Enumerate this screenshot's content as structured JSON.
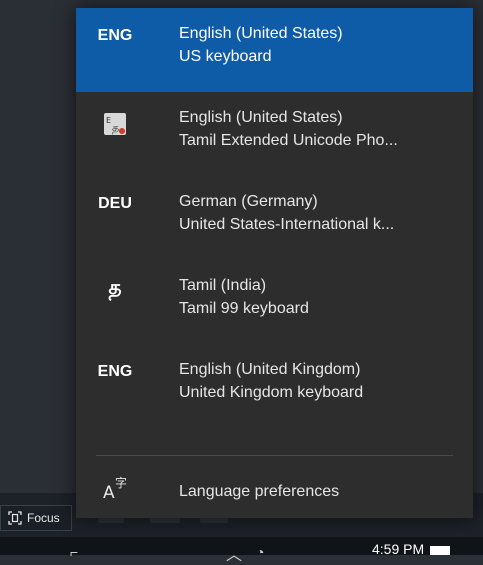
{
  "focus_button": {
    "label": "Focus",
    "icon": "focus-icon"
  },
  "languages": [
    {
      "code": "ENG",
      "name": "English (United States)",
      "keyboard": "US keyboard",
      "selected": true
    },
    {
      "code": "",
      "icon": "tamil-phonetic-ime-icon",
      "name": "English (United States)",
      "keyboard": "Tamil Extended Unicode Pho...",
      "selected": false
    },
    {
      "code": "DEU",
      "name": "German (Germany)",
      "keyboard": "United States-International k...",
      "selected": false
    },
    {
      "code": "த",
      "name": "Tamil (India)",
      "keyboard": "Tamil 99 keyboard",
      "selected": false
    },
    {
      "code": "ENG",
      "name": "English (United Kingdom)",
      "keyboard": "United Kingdom keyboard",
      "selected": false
    }
  ],
  "preferences": {
    "label": "Language preferences",
    "icon": "language-preferences-icon"
  },
  "taskbar": {
    "time": "4:59 PM"
  },
  "colors": {
    "selected_bg": "#0e5ba8",
    "flyout_bg": "#2d2d2d",
    "desktop_bg": "#2a2e35"
  }
}
